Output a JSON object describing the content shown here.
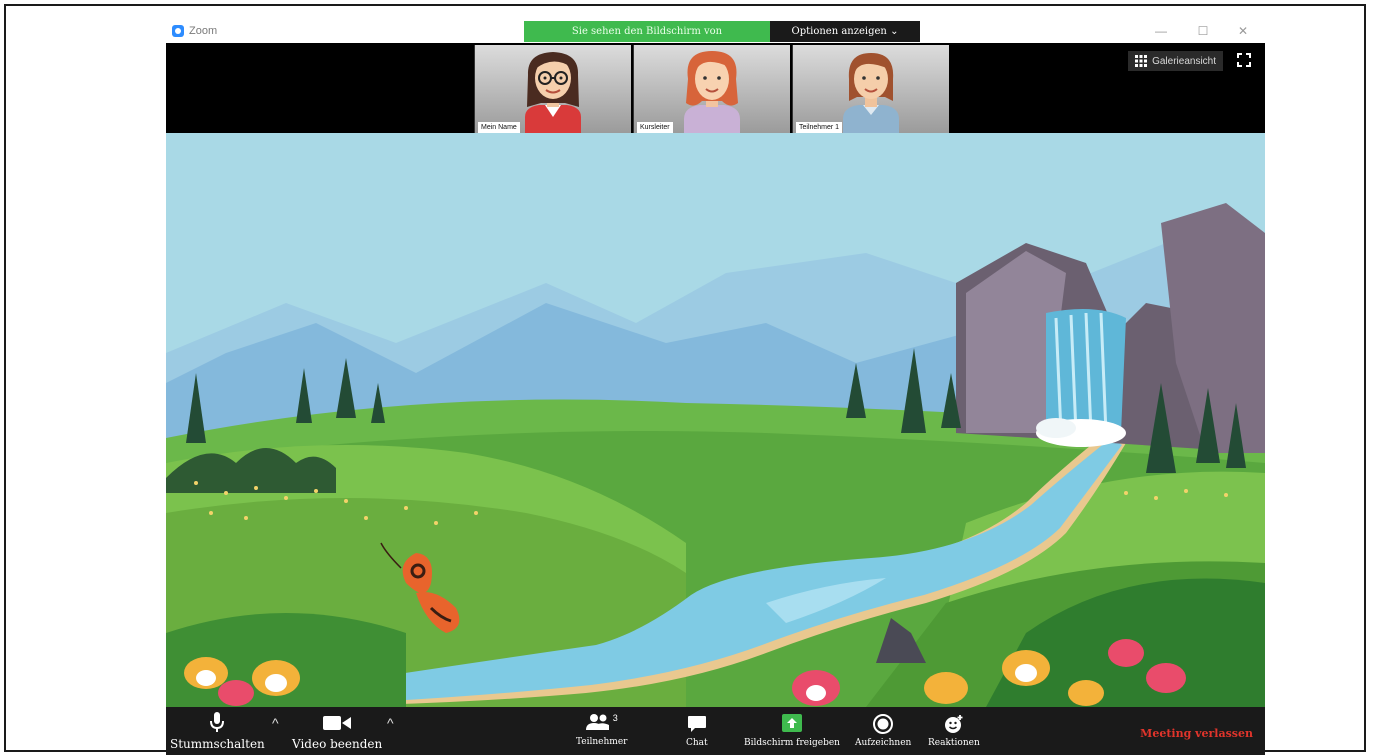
{
  "window": {
    "app_title": "Zoom",
    "share_banner": "Sie sehen den Bildschirm von",
    "options_label": "Optionen anzeigen",
    "options_caret": "⌄",
    "controls": {
      "minimize": "—",
      "maximize": "☐",
      "close": "✕"
    }
  },
  "participants": [
    {
      "name": "Mein Name",
      "hair": "#4a2b20",
      "shirt": "#d93a3a",
      "glasses": true
    },
    {
      "name": "Kursleiter",
      "hair": "#d7643a",
      "shirt": "#c9b1d6",
      "glasses": false
    },
    {
      "name": "Teilnehmer 1",
      "hair": "#a0512e",
      "shirt": "#8fb3cf",
      "glasses": false
    }
  ],
  "view": {
    "gallery_label": "Galerieansicht",
    "gallery_icon": "grid-icon",
    "fullscreen_icon": "fullscreen-icon"
  },
  "toolbar": {
    "mute_label": "Stummschalten",
    "video_label": "Video beenden",
    "participants_label": "Teilnehmer",
    "participants_count": "3",
    "chat_label": "Chat",
    "share_label": "Bildschirm freigeben",
    "record_label": "Aufzeichnen",
    "reactions_label": "Reaktionen",
    "leave_label": "Meeting verlassen",
    "caret": "^"
  },
  "colors": {
    "share_green": "#3fba4e",
    "toolbar_bg": "#1a1a1a",
    "leave_red": "#e0342b",
    "sky": "#a9d9e6"
  }
}
